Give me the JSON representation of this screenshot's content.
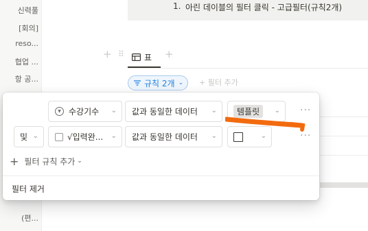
{
  "sidebar": {
    "items": [
      {
        "label": "신력풀"
      },
      {
        "label": "[회의]"
      },
      {
        "label": "reso..."
      },
      {
        "label": "협업 ..."
      },
      {
        "label": "항 공..."
      },
      {
        "label": "(편..."
      }
    ]
  },
  "callout": {
    "number": "1.",
    "text": "아린 데이블의 필터 클릭 - 고급필터(규칙2개)"
  },
  "view": {
    "tab_label": "표",
    "table_icon": "table-icon"
  },
  "filter_chip": {
    "label": "규칙 2개",
    "icon": "filter-lines-icon"
  },
  "add_filter_faint": "필터 추가",
  "popover": {
    "rules": [
      {
        "connector": "",
        "property": "수강기수",
        "property_icon": "select-circle-icon",
        "operator": "값과 동일한 데이터",
        "value": "템플릿"
      },
      {
        "connector": "및",
        "property": "√입력완...",
        "property_icon": "checkbox-icon",
        "operator": "값과 동일한 데이터",
        "value": ""
      }
    ],
    "add_rule_label": "필터 규칙 추가",
    "remove_filter_label": "필터 제거"
  },
  "colors": {
    "accent_blue": "#2383e2",
    "annotation_orange": "#f26b0f",
    "tag_gray": "#e3e2e0"
  }
}
